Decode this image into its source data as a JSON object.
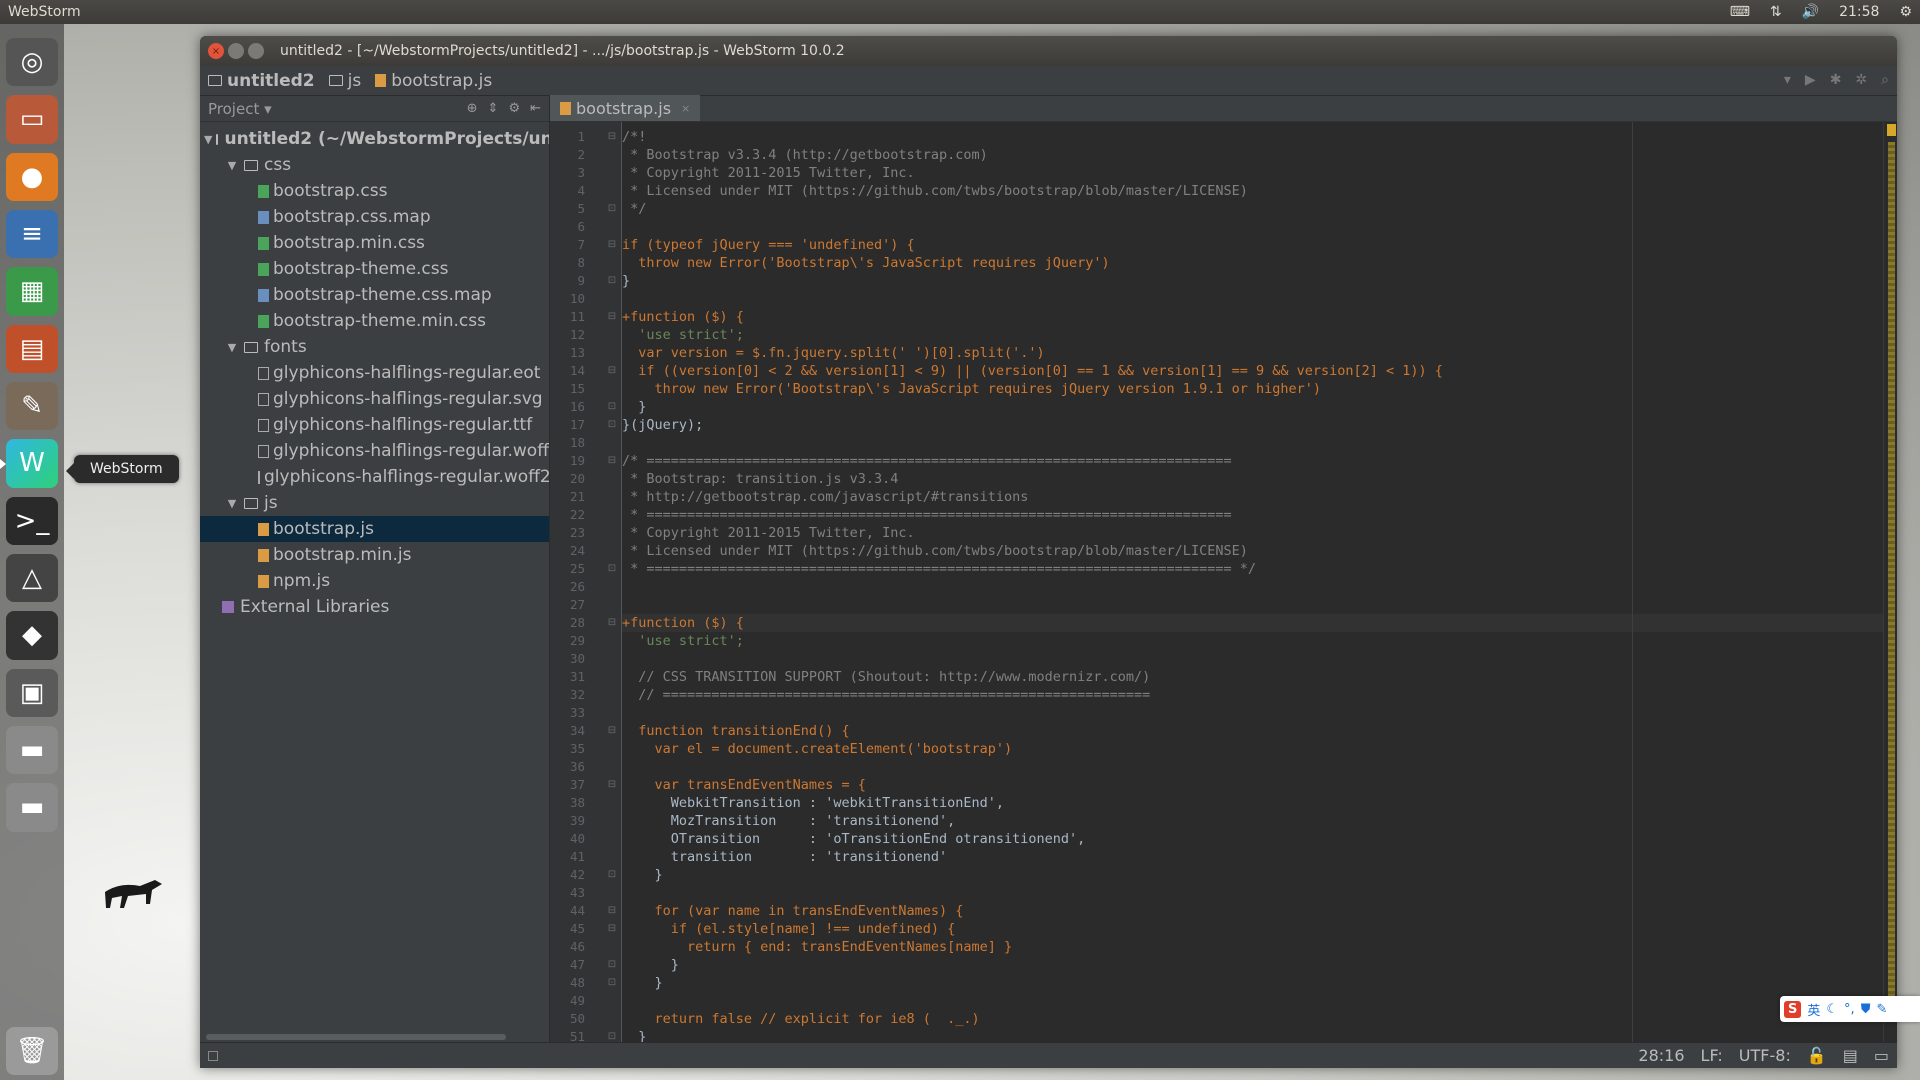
{
  "top_panel": {
    "app_name": "WebStorm",
    "time": "21:58"
  },
  "launcher": {
    "tooltip": "WebStorm",
    "icons": [
      "dash-icon",
      "files-icon",
      "firefox-icon",
      "writer-icon",
      "calc-icon",
      "impress-icon",
      "settings-icon",
      "webstorm-icon",
      "terminal-icon",
      "vlc-icon",
      "inkscape-icon",
      "workspace-icon",
      "drive-icon",
      "drive-icon-2",
      "trash-icon"
    ]
  },
  "window": {
    "title": "untitled2 - [~/WebstormProjects/untitled2] - .../js/bootstrap.js - WebStorm 10.0.2"
  },
  "nav_bar": {
    "crumbs": [
      "untitled2",
      "js",
      "bootstrap.js"
    ]
  },
  "project_panel": {
    "title": "Project",
    "tree": [
      {
        "label": "untitled2 (~/WebstormProjects/untitle",
        "type": "root"
      },
      {
        "label": "css",
        "type": "folder"
      },
      {
        "label": "bootstrap.css",
        "type": "css"
      },
      {
        "label": "bootstrap.css.map",
        "type": "map"
      },
      {
        "label": "bootstrap.min.css",
        "type": "css"
      },
      {
        "label": "bootstrap-theme.css",
        "type": "css"
      },
      {
        "label": "bootstrap-theme.css.map",
        "type": "map"
      },
      {
        "label": "bootstrap-theme.min.css",
        "type": "css"
      },
      {
        "label": "fonts",
        "type": "folder"
      },
      {
        "label": "glyphicons-halflings-regular.eot",
        "type": "font"
      },
      {
        "label": "glyphicons-halflings-regular.svg",
        "type": "font"
      },
      {
        "label": "glyphicons-halflings-regular.ttf",
        "type": "font"
      },
      {
        "label": "glyphicons-halflings-regular.woff",
        "type": "font"
      },
      {
        "label": "glyphicons-halflings-regular.woff2",
        "type": "font"
      },
      {
        "label": "js",
        "type": "folder"
      },
      {
        "label": "bootstrap.js",
        "type": "js",
        "selected": true
      },
      {
        "label": "bootstrap.min.js",
        "type": "js"
      },
      {
        "label": "npm.js",
        "type": "js"
      },
      {
        "label": "External Libraries",
        "type": "lib"
      }
    ]
  },
  "editor": {
    "tab_label": "bootstrap.js",
    "lines": [
      "/*!",
      " * Bootstrap v3.3.4 (http://getbootstrap.com)",
      " * Copyright 2011-2015 Twitter, Inc.",
      " * Licensed under MIT (https://github.com/twbs/bootstrap/blob/master/LICENSE)",
      " */",
      "",
      "if (typeof jQuery === 'undefined') {",
      "  throw new Error('Bootstrap\\'s JavaScript requires jQuery')",
      "}",
      "",
      "+function ($) {",
      "  'use strict';",
      "  var version = $.fn.jquery.split(' ')[0].split('.')",
      "  if ((version[0] < 2 && version[1] < 9) || (version[0] == 1 && version[1] == 9 && version[2] < 1)) {",
      "    throw new Error('Bootstrap\\'s JavaScript requires jQuery version 1.9.1 or higher')",
      "  }",
      "}(jQuery);",
      "",
      "/* ========================================================================",
      " * Bootstrap: transition.js v3.3.4",
      " * http://getbootstrap.com/javascript/#transitions",
      " * ========================================================================",
      " * Copyright 2011-2015 Twitter, Inc.",
      " * Licensed under MIT (https://github.com/twbs/bootstrap/blob/master/LICENSE)",
      " * ======================================================================== */",
      "",
      "",
      "+function ($) {",
      "  'use strict';",
      "",
      "  // CSS TRANSITION SUPPORT (Shoutout: http://www.modernizr.com/)",
      "  // ============================================================",
      "",
      "  function transitionEnd() {",
      "    var el = document.createElement('bootstrap')",
      "",
      "    var transEndEventNames = {",
      "      WebkitTransition : 'webkitTransitionEnd',",
      "      MozTransition    : 'transitionend',",
      "      OTransition      : 'oTransitionEnd otransitionend',",
      "      transition       : 'transitionend'",
      "    }",
      "",
      "    for (var name in transEndEventNames) {",
      "      if (el.style[name] !== undefined) {",
      "        return { end: transEndEventNames[name] }",
      "      }",
      "    }",
      "",
      "    return false // explicit for ie8 (  ._.)",
      "  }"
    ]
  },
  "status_bar": {
    "position": "28:16",
    "line_sep": "LF",
    "encoding": "UTF-8"
  },
  "ime": {
    "label": "英"
  }
}
